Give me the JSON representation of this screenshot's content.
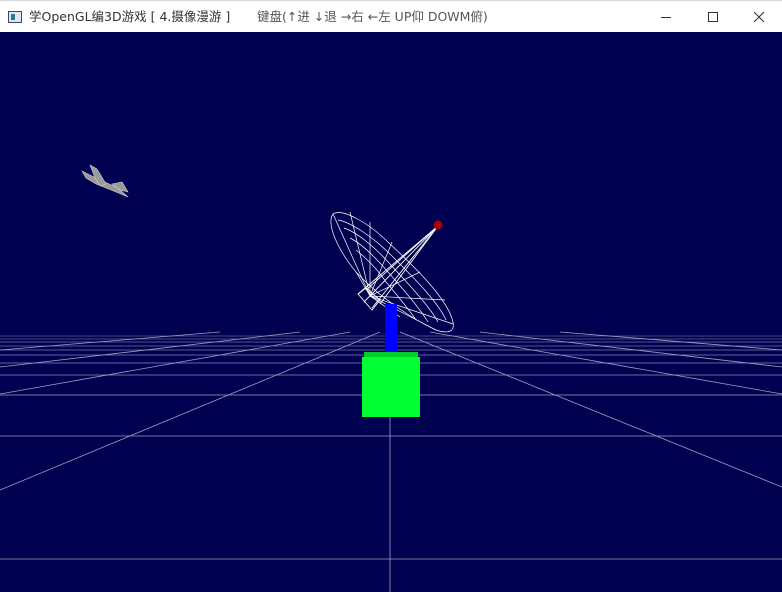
{
  "window": {
    "title": "学OpenGL编3D游戏 [ 4.摄像漫游 ]",
    "help_text": "键盘(↑进 ↓退 →右 ←左 UP仰 DOWM俯)"
  },
  "buttons": {
    "minimize": "minimize",
    "maximize": "maximize",
    "close": "close"
  },
  "scene": {
    "background_color": "#000050",
    "grid_color": "#9aa0c0",
    "cube_color": "#00ff33",
    "pole_color": "#0000ff",
    "dish_wire_color": "#ffffff",
    "dish_tip_color": "#aa0000",
    "airplane_color": "#9a9a9a"
  },
  "icons": [
    "app-icon",
    "minimize-icon",
    "maximize-icon",
    "close-icon"
  ]
}
